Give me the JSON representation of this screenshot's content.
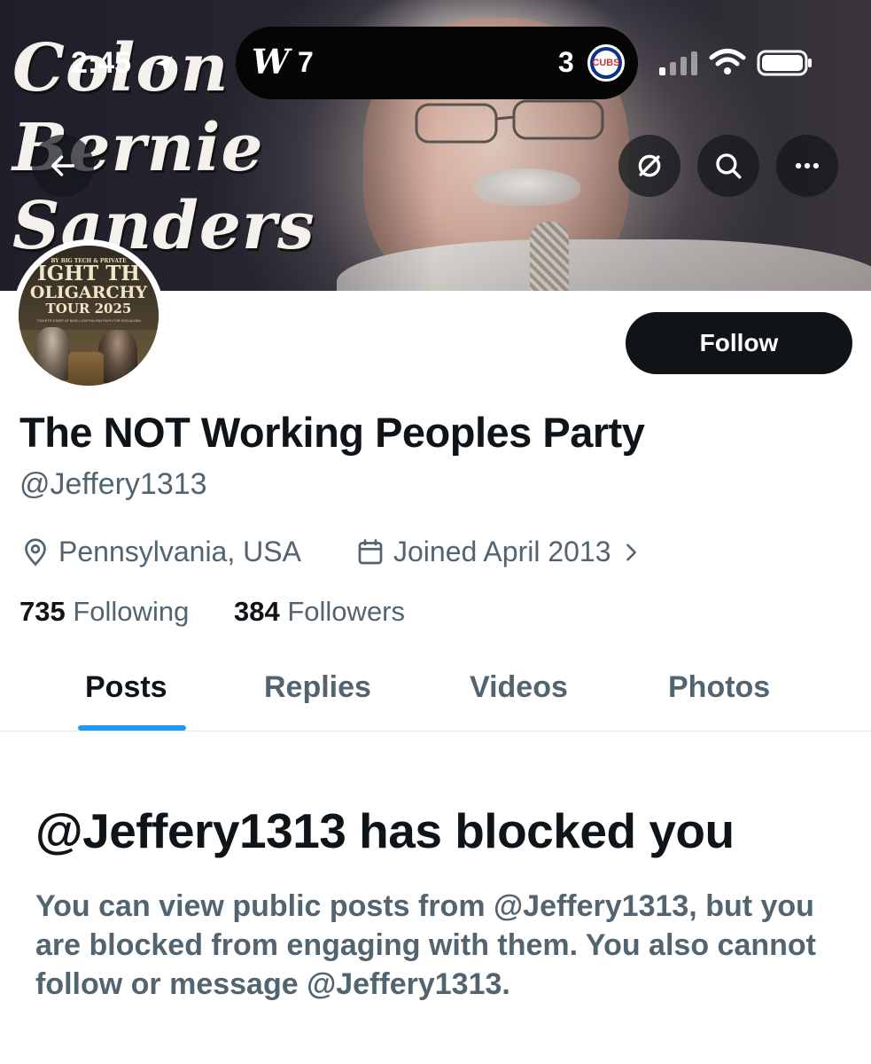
{
  "status_bar": {
    "time": "2:45",
    "score_left_team_logo": "W",
    "score_left": "7",
    "score_right": "3",
    "score_right_team_logo": "CUBS"
  },
  "banner": {
    "title_lines": [
      "Colon",
      "Bernie",
      "Sanders"
    ]
  },
  "avatar": {
    "lines": [
      "BY BIG TECH & PRIVATE",
      "IGHT TH",
      "OLIGARCHY",
      "TOUR 2025",
      "TICKETS START AT $499 • CAPITALISM PAYS FOR SOCIALISM"
    ]
  },
  "actions": {
    "follow_label": "Follow"
  },
  "profile": {
    "display_name": "The NOT Working Peoples Party",
    "handle": "@Jeffery1313",
    "location": "Pennsylvania, USA",
    "joined": "Joined April 2013",
    "following_count": "735",
    "following_label": "Following",
    "followers_count": "384",
    "followers_label": "Followers"
  },
  "tabs": [
    {
      "label": "Posts",
      "active": true
    },
    {
      "label": "Replies",
      "active": false
    },
    {
      "label": "Videos",
      "active": false
    },
    {
      "label": "Photos",
      "active": false
    }
  ],
  "blocked": {
    "title": "@Jeffery1313 has blocked you",
    "body": "You can view public posts from @Jeffery1313, but you are blocked from engaging with them. You also cannot follow or message @Jeffery1313."
  },
  "colors": {
    "accent": "#1d9bf0",
    "text_primary": "#0f1419",
    "text_secondary": "#536471"
  },
  "icons": [
    "back-arrow-icon",
    "hide-icon",
    "search-icon",
    "more-icon",
    "location-icon",
    "calendar-icon",
    "chevron-right-icon",
    "wifi-icon",
    "battery-icon",
    "signal-icon",
    "location-arrow-icon"
  ]
}
